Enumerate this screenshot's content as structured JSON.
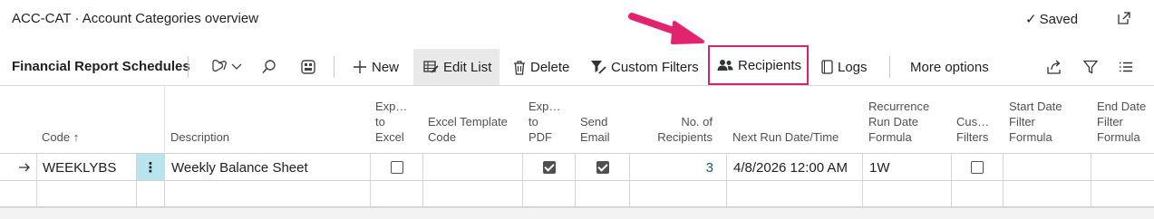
{
  "window": {
    "title": "ACC-CAT · Account Categories overview",
    "saved_label": "Saved",
    "popout_icon": "popout-icon"
  },
  "actionbar": {
    "page_name": "Financial Report Schedules",
    "new_label": "New",
    "edit_list_label": "Edit List",
    "delete_label": "Delete",
    "custom_filters_label": "Custom Filters",
    "recipients_label": "Recipients",
    "logs_label": "Logs",
    "more_options_label": "More options"
  },
  "colors": {
    "highlight": "#d6226f",
    "row_marker": "#b9e4ee",
    "active_bg": "#e9e9e9"
  },
  "table": {
    "headers": {
      "code": "Code ↑",
      "description": "Description",
      "export_excel": [
        "Exp…",
        "to",
        "Excel"
      ],
      "excel_template": [
        "Excel Template",
        "Code"
      ],
      "export_pdf": [
        "Exp…",
        "to",
        "PDF"
      ],
      "send_email": [
        "Send",
        "Email"
      ],
      "recipients": [
        "No. of",
        "Recipients"
      ],
      "next_run": "Next Run Date/Time",
      "recurrence": [
        "Recurrence",
        "Run Date",
        "Formula"
      ],
      "custom_filters": [
        "Cus…",
        "Filters"
      ],
      "start_date": [
        "Start Date",
        "Filter",
        "Formula"
      ],
      "end_date": [
        "End Date",
        "Filter",
        "Formula"
      ]
    },
    "rows": [
      {
        "code": "WEEKLYBS",
        "description": "Weekly Balance Sheet",
        "export_excel": false,
        "excel_template": "",
        "export_pdf": true,
        "send_email": true,
        "recipients": "3",
        "next_run": "4/8/2026 12:00 AM",
        "recurrence": "1W",
        "custom_filters": false,
        "start_date": "",
        "end_date": ""
      }
    ]
  }
}
